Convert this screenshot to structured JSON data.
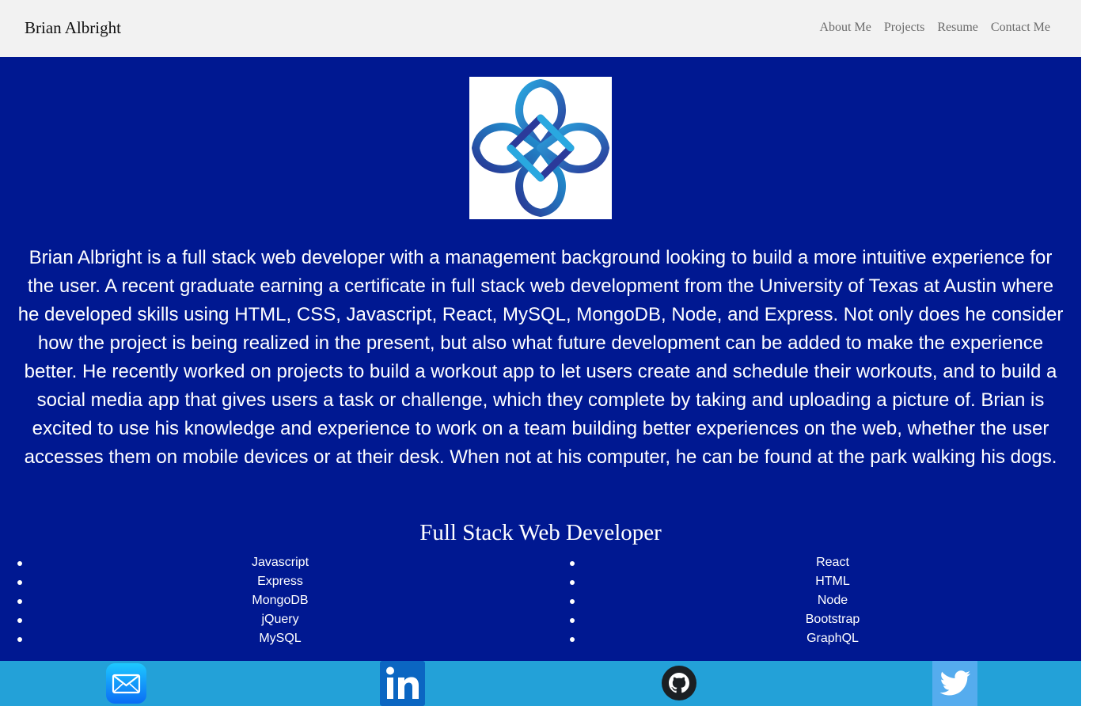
{
  "navbar": {
    "brand": "Brian Albright",
    "links": [
      "About Me",
      "Projects",
      "Resume",
      "Contact Me"
    ],
    "background": "#f2f2f2"
  },
  "main": {
    "background": "#001891",
    "logo_icon": "celtic-knot-logo",
    "bio": "Brian Albright is a full stack web developer with a management background looking to build a more intuitive experience for the user. A recent graduate earning a certificate in full stack web development from the University of Texas at Austin where he developed skills using HTML, CSS, Javascript, React, MySQL, MongoDB, Node, and Express. Not only does he consider how the project is being realized in the present, but also what future development can be added to make the experience better. He recently worked on projects to build a workout app to let users create and schedule their workouts, and to build a social media app that gives users a task or challenge, which they complete by taking and uploading a picture of. Brian is excited to use his knowledge and experience to work on a team building better experiences on the web, whether the user accesses them on mobile devices or at their desk. When not at his computer, he can be found at the park walking his dogs.",
    "role_title": "Full Stack Web Developer",
    "skills_left": [
      "Javascript",
      "Express",
      "MongoDB",
      "jQuery",
      "MySQL"
    ],
    "skills_right": [
      "React",
      "HTML",
      "Node",
      "Bootstrap",
      "GraphQL"
    ]
  },
  "footer": {
    "background": "#23a1d8",
    "icons": [
      "mail-icon",
      "linkedin-icon",
      "github-icon",
      "twitter-icon"
    ]
  }
}
